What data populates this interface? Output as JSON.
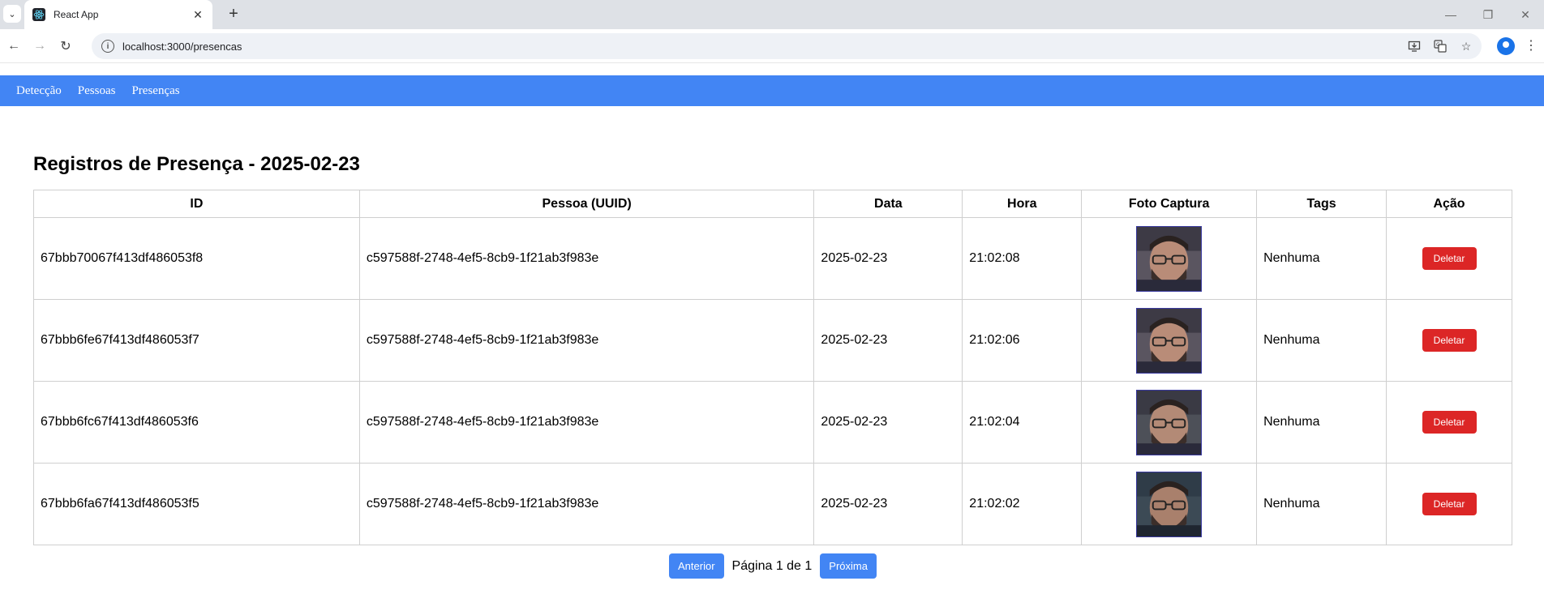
{
  "browser": {
    "tab_title": "React App",
    "url": "localhost:3000/presencas",
    "tab_close": "✕",
    "new_tab": "+",
    "minimize": "—",
    "restore": "❐",
    "close": "✕"
  },
  "nav": {
    "items": [
      {
        "label": "Detecção"
      },
      {
        "label": "Pessoas"
      },
      {
        "label": "Presenças"
      }
    ]
  },
  "page": {
    "title": "Registros de Presença - 2025-02-23"
  },
  "table": {
    "headers": [
      "ID",
      "Pessoa (UUID)",
      "Data",
      "Hora",
      "Foto Captura",
      "Tags",
      "Ação"
    ],
    "rows": [
      {
        "id": "67bbb70067f413df486053f8",
        "pessoa": "c597588f-2748-4ef5-8cb9-1f21ab3f983e",
        "data": "2025-02-23",
        "hora": "21:02:08",
        "tags": "Nenhuma",
        "action": "Deletar"
      },
      {
        "id": "67bbb6fe67f413df486053f7",
        "pessoa": "c597588f-2748-4ef5-8cb9-1f21ab3f983e",
        "data": "2025-02-23",
        "hora": "21:02:06",
        "tags": "Nenhuma",
        "action": "Deletar"
      },
      {
        "id": "67bbb6fc67f413df486053f6",
        "pessoa": "c597588f-2748-4ef5-8cb9-1f21ab3f983e",
        "data": "2025-02-23",
        "hora": "21:02:04",
        "tags": "Nenhuma",
        "action": "Deletar"
      },
      {
        "id": "67bbb6fa67f413df486053f5",
        "pessoa": "c597588f-2748-4ef5-8cb9-1f21ab3f983e",
        "data": "2025-02-23",
        "hora": "21:02:02",
        "tags": "Nenhuma",
        "action": "Deletar"
      }
    ]
  },
  "pager": {
    "prev": "Anterior",
    "status": "Página 1 de 1",
    "next": "Próxima"
  },
  "colors": {
    "nav_bg": "#4285f4",
    "delete_btn": "#dc2626",
    "page_btn": "#4285f4"
  }
}
